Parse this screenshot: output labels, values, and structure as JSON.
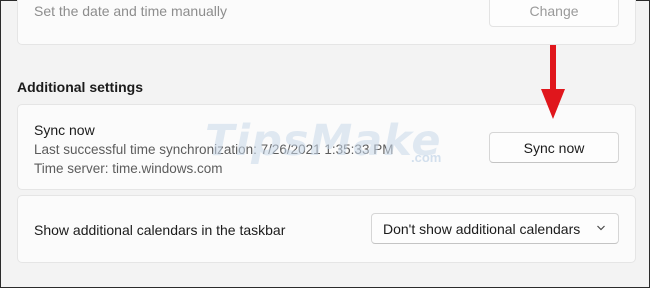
{
  "manual": {
    "label": "Set the date and time manually",
    "button": "Change"
  },
  "additional": {
    "title": "Additional settings",
    "sync": {
      "title": "Sync now",
      "last_sync": "Last successful time synchronization: 7/26/2021 1:35:33 PM",
      "server": "Time server: time.windows.com",
      "button": "Sync now"
    },
    "calendars": {
      "label": "Show additional calendars in the taskbar",
      "selected": "Don't show additional calendars"
    }
  },
  "watermark": {
    "text": "TipsMake",
    "domain": ".com"
  },
  "colors": {
    "annotation_arrow": "#e0161c",
    "watermark": "#c9d9ea"
  }
}
